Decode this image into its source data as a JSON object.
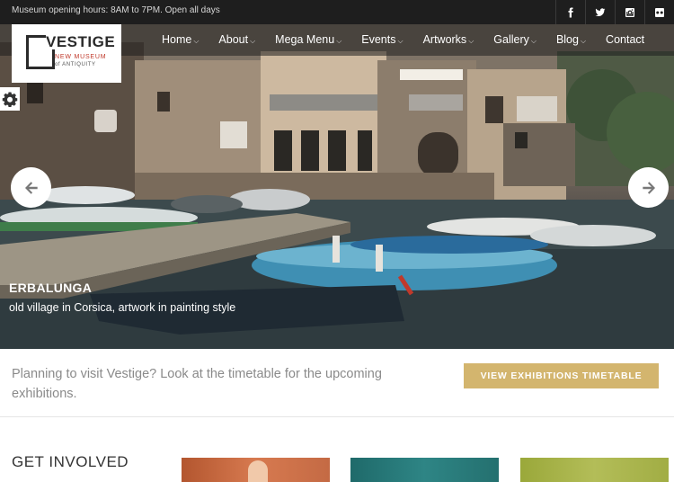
{
  "topbar": {
    "hours": "Museum opening hours: 8AM to 7PM. Open all days",
    "social": [
      "facebook-icon",
      "twitter-icon",
      "instagram-icon",
      "flickr-icon"
    ]
  },
  "logo": {
    "name": "VESTIGE",
    "tagline_1": "NEW MUSEUM",
    "tagline_2": "of ANTIQUITY"
  },
  "nav": {
    "items": [
      {
        "label": "Home",
        "has_dropdown": true
      },
      {
        "label": "About",
        "has_dropdown": true
      },
      {
        "label": "Mega Menu",
        "has_dropdown": true
      },
      {
        "label": "Events",
        "has_dropdown": true
      },
      {
        "label": "Artworks",
        "has_dropdown": true
      },
      {
        "label": "Gallery",
        "has_dropdown": true
      },
      {
        "label": "Blog",
        "has_dropdown": true
      },
      {
        "label": "Contact",
        "has_dropdown": false
      }
    ]
  },
  "slider": {
    "title": "ERBALUNGA",
    "subtitle": "old village in Corsica, artwork in painting style"
  },
  "cta": {
    "text": "Planning to visit Vestige? Look at the timetable for the upcoming exhibitions.",
    "button": "VIEW EXHIBITIONS TIMETABLE"
  },
  "section": {
    "title": "GET INVOLVED"
  },
  "colors": {
    "accent": "#d3b56e",
    "topbar_bg": "#1e1e1e",
    "logo_red": "#c0392b"
  }
}
